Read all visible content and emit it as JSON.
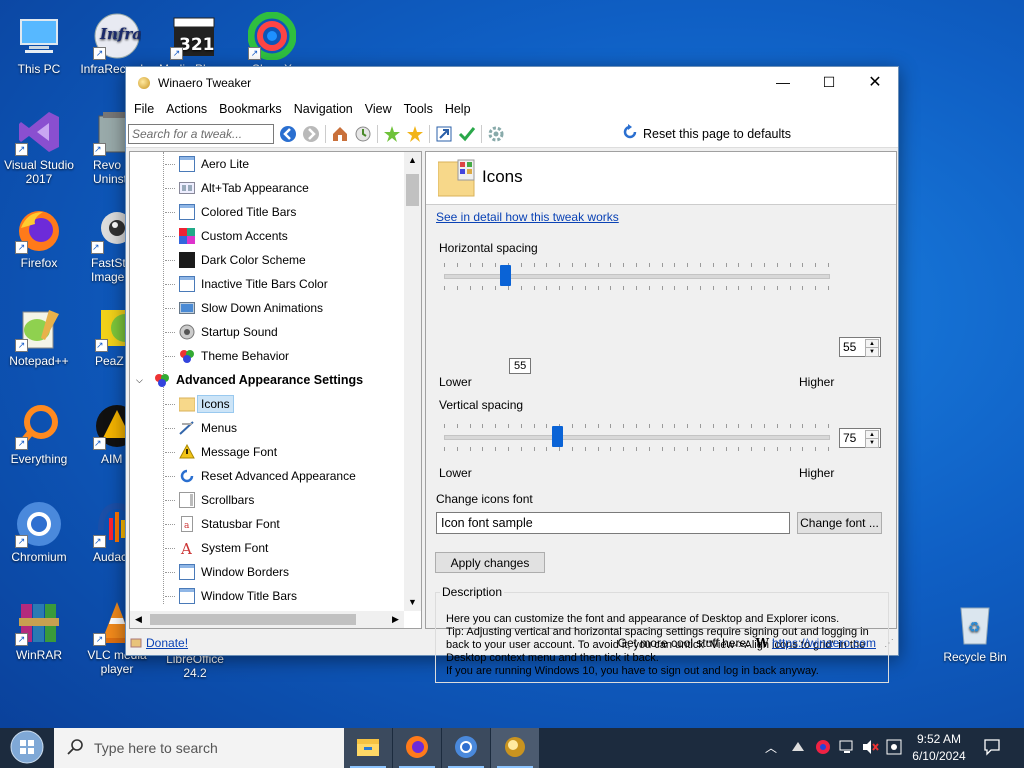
{
  "desktop": {
    "icons": [
      {
        "label": "This PC"
      },
      {
        "label": "InfraRecorder"
      },
      {
        "label": "Media Player"
      },
      {
        "label": "ShareX"
      },
      {
        "label": "Visual Studio 2017"
      },
      {
        "label": "Revo Uninsta"
      },
      {
        "label": "Firefox"
      },
      {
        "label": "FastSto Image V"
      },
      {
        "label": "Notepad++"
      },
      {
        "label": "PeaZ"
      },
      {
        "label": "Everything"
      },
      {
        "label": "AIM"
      },
      {
        "label": "Chromium"
      },
      {
        "label": "Audac"
      },
      {
        "label": "WinRAR"
      },
      {
        "label": "VLC media player"
      },
      {
        "label": "LibreOffice 24.2"
      },
      {
        "label": "Recycle Bin"
      }
    ],
    "infra_logo_text": "Infra",
    "media_player_digits": "321"
  },
  "window": {
    "title": "Winaero Tweaker",
    "menu": [
      "File",
      "Actions",
      "Bookmarks",
      "Navigation",
      "View",
      "Tools",
      "Help"
    ],
    "search_placeholder": "Search for a tweak...",
    "reset_label": "Reset this page to defaults"
  },
  "tree": {
    "items": [
      {
        "label": "Aero Lite",
        "icon": "window-frame-icon"
      },
      {
        "label": "Alt+Tab Appearance",
        "icon": "alt-tab-icon"
      },
      {
        "label": "Colored Title Bars",
        "icon": "window-frame-icon"
      },
      {
        "label": "Custom Accents",
        "icon": "color-palette-icon"
      },
      {
        "label": "Dark Color Scheme",
        "icon": "dark-square-icon"
      },
      {
        "label": "Inactive Title Bars Color",
        "icon": "window-frame-icon"
      },
      {
        "label": "Slow Down Animations",
        "icon": "animation-icon"
      },
      {
        "label": "Startup Sound",
        "icon": "speaker-icon"
      },
      {
        "label": "Theme Behavior",
        "icon": "theme-icon"
      }
    ],
    "category": "Advanced Appearance Settings",
    "sub_items": [
      {
        "label": "Icons",
        "icon": "icons-folder-icon",
        "selected": true
      },
      {
        "label": "Menus",
        "icon": "menu-icon"
      },
      {
        "label": "Message Font",
        "icon": "warning-icon"
      },
      {
        "label": "Reset Advanced Appearance",
        "icon": "reset-icon"
      },
      {
        "label": "Scrollbars",
        "icon": "scrollbar-icon"
      },
      {
        "label": "Statusbar Font",
        "icon": "statusbar-icon"
      },
      {
        "label": "System Font",
        "icon": "font-icon"
      },
      {
        "label": "Window Borders",
        "icon": "window-frame-icon"
      },
      {
        "label": "Window Title Bars",
        "icon": "window-frame-icon"
      }
    ]
  },
  "pane": {
    "title": "Icons",
    "detail_link": "See in detail how this tweak works",
    "horizontal": {
      "label": "Horizontal spacing",
      "value": "55",
      "tooltip": "55",
      "fraction": 0.16,
      "lower": "Lower",
      "higher": "Higher"
    },
    "vertical": {
      "label": "Vertical spacing",
      "value": "75",
      "fraction": 0.295,
      "lower": "Lower",
      "higher": "Higher"
    },
    "font_label": "Change icons font",
    "font_sample": "Icon font sample",
    "change_font_button": "Change font ...",
    "apply_button": "Apply changes",
    "description_title": "Description",
    "description_lines": [
      "Here you can customize the font and appearance of Desktop and Explorer icons.",
      "Tip: Adjusting vertical and horizontal spacing settings require signing out and logging in back to your user account. To avoid it, you can untick \"View->Align icons to grid\" in the Desktop context menu and then tick it back.",
      "If you are running Windows 10, you have to sign out and log in back anyway."
    ]
  },
  "statusbar": {
    "donate": "Donate!",
    "promo": "Get more cool stuff here:",
    "url": "https://winaero.com",
    "w_glyph": "W"
  },
  "taskbar": {
    "search_placeholder": "Type here to search",
    "time": "9:52 AM",
    "date": "6/10/2024"
  },
  "colors": {
    "accent": "#0a63d6",
    "link": "#0a42b5",
    "taskbar": "#1c2b3e"
  }
}
